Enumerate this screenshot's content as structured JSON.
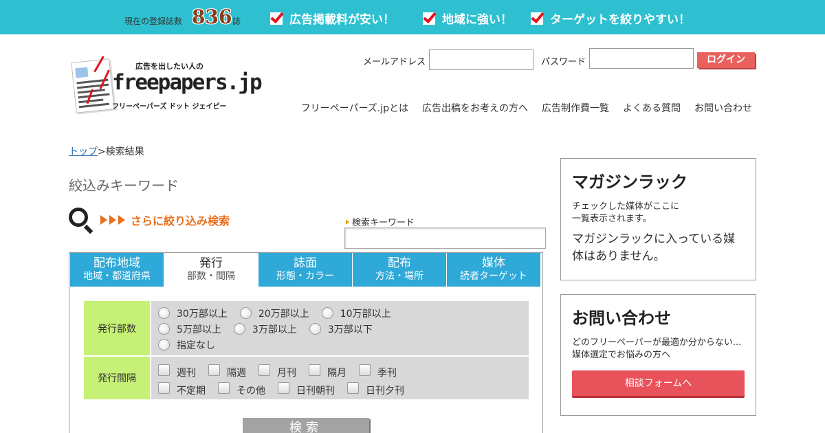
{
  "topbar": {
    "reg_label": "現在の登録誌数",
    "reg_count": "836",
    "reg_unit": "誌",
    "features": [
      "広告掲載料が安い！",
      "地域に強い！",
      "ターゲットを絞りやすい！"
    ]
  },
  "logo": {
    "tagline": "広告を出したい人の",
    "name": "freepapers.jp",
    "reading": "フリーペーパーズ ドット ジェイピー"
  },
  "login": {
    "email_label": "メールアドレス",
    "password_label": "パスワード",
    "button": "ログイン"
  },
  "nav": [
    "フリーペーパーズ.jpとは",
    "広告出稿をお考えの方へ",
    "広告制作費一覧",
    "よくある質問",
    "お問い合わせ"
  ],
  "breadcrumb": {
    "home": "トップ",
    "current": ">検索結果"
  },
  "section_title": "絞込みキーワード",
  "search": {
    "title": "さらに絞り込み検索",
    "keyword_label": "検索キーワード",
    "button": "検索"
  },
  "tabs": [
    {
      "t1": "配布地域",
      "t2": "地域・都道府県",
      "active": false
    },
    {
      "t1": "発行",
      "t2": "部数・間隔",
      "active": true
    },
    {
      "t1": "誌面",
      "t2": "形態・カラー",
      "active": false
    },
    {
      "t1": "配布",
      "t2": "方法・場所",
      "active": false
    },
    {
      "t1": "媒体",
      "t2": "読者ターゲット",
      "active": false
    }
  ],
  "filters": {
    "circulation": {
      "label": "発行部数",
      "rows": [
        [
          "30万部以上",
          "20万部以上",
          "10万部以上"
        ],
        [
          "5万部以上",
          "3万部以上",
          "3万部以下"
        ],
        [
          "指定なし"
        ]
      ]
    },
    "interval": {
      "label": "発行間隔",
      "rows": [
        [
          "週刊",
          "隔週",
          "月刊",
          "隔月",
          "季刊"
        ],
        [
          "不定期",
          "その他",
          "日刊朝刊",
          "日刊夕刊"
        ]
      ]
    }
  },
  "sidebar": {
    "rack": {
      "title": "マガジンラック",
      "desc1": "チェックした媒体がここに",
      "desc2": "一覧表示されます。",
      "empty": "マガジンラックに入っている媒体はありません。"
    },
    "contact": {
      "title": "お問い合わせ",
      "desc1": "どのフリーペーパーが最適か分からない...",
      "desc2": "媒体選定でお悩みの方へ",
      "button": "相談フォームへ"
    }
  }
}
